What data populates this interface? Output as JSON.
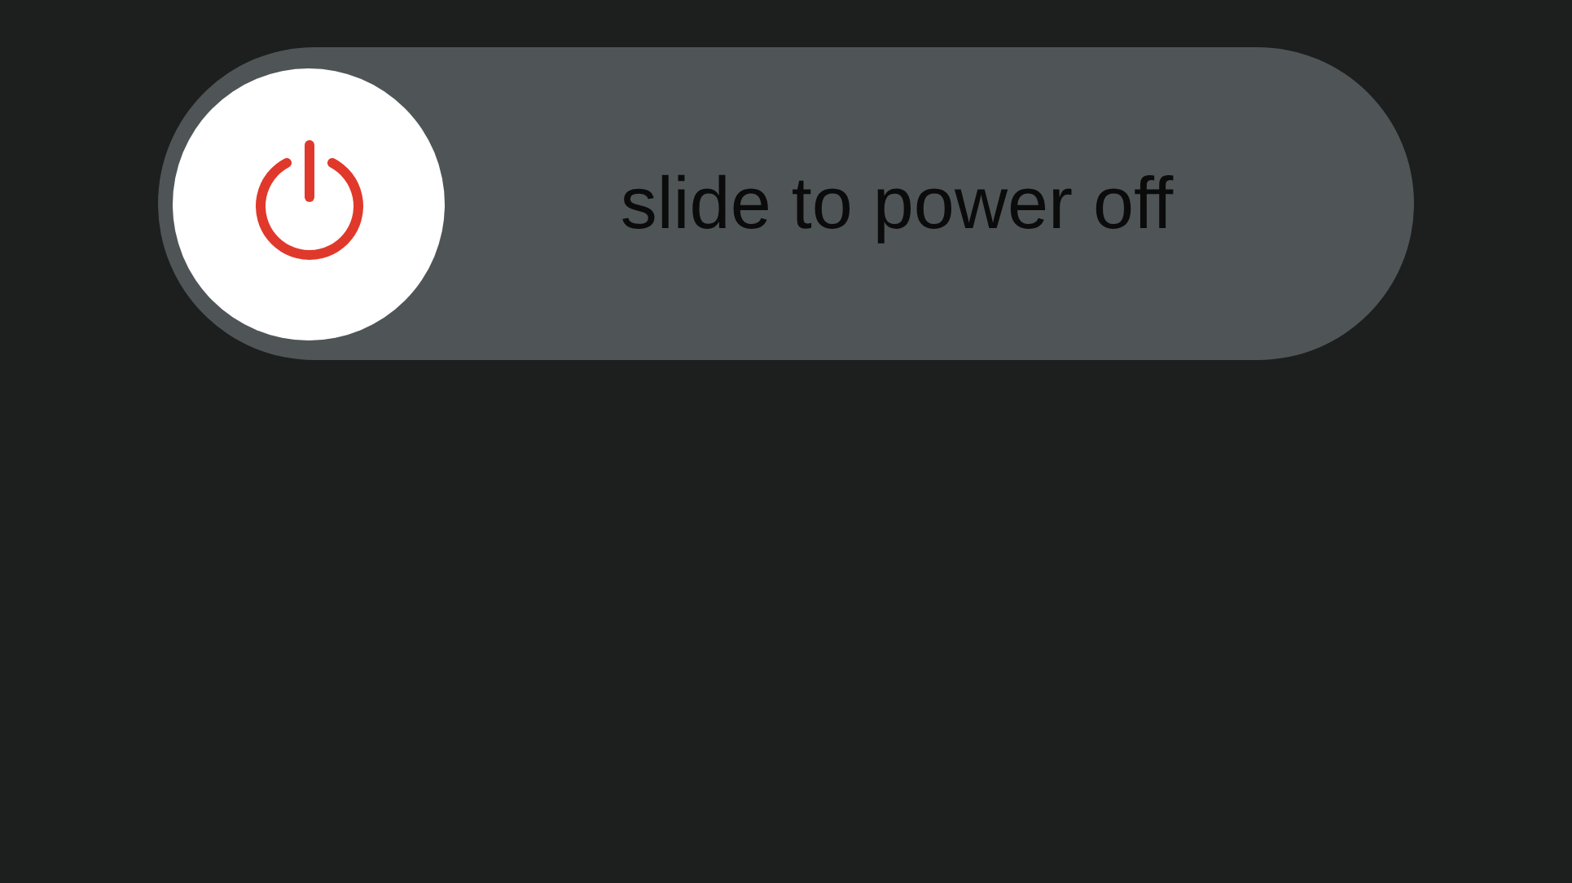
{
  "slider": {
    "label": "slide to power off",
    "level": 0
  }
}
